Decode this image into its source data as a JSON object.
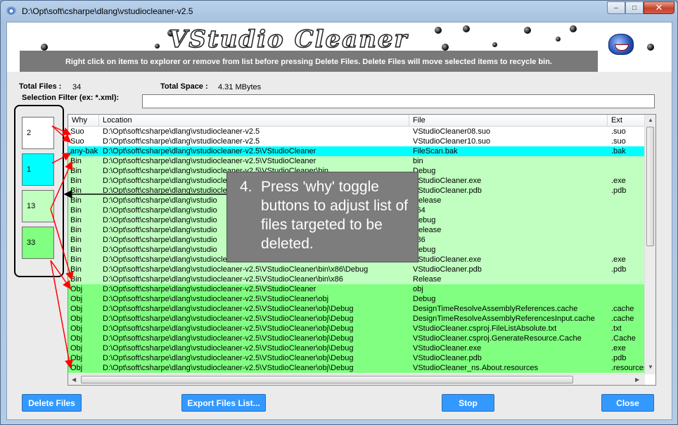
{
  "window": {
    "title": "D:\\Opt\\soft\\csharpe\\dlang\\vstudiocleaner-v2.5",
    "buttons": {
      "minimize": "–",
      "maximize": "□",
      "close": "✕"
    }
  },
  "banner": {
    "logo": "VStudio Cleaner",
    "instructions": "Right click on items to explorer or remove from list before pressing Delete Files.  Delete Files will move selected items to recycle bin."
  },
  "stats": {
    "total_files_label": "Total Files :",
    "total_files_value": "34",
    "total_space_label": "Total Space :",
    "total_space_value": "4.31 MBytes",
    "filter_label": "Selection Filter (ex: *.xml):",
    "filter_value": ""
  },
  "toggles": [
    {
      "count": "2",
      "color": "#ffffff"
    },
    {
      "count": "1",
      "color": "#00ffff"
    },
    {
      "count": "13",
      "color": "#c0ffc0"
    },
    {
      "count": "33",
      "color": "#80ff80"
    }
  ],
  "list": {
    "columns": [
      "Why",
      "Location",
      "File",
      "Ext"
    ],
    "rows": [
      {
        "why": "Suo",
        "location": "D:\\Opt\\soft\\csharpe\\dlang\\vstudiocleaner-v2.5",
        "file": "VStudioCleaner08.suo",
        "ext": ".suo",
        "color": "#ffffff"
      },
      {
        "why": "Suo",
        "location": "D:\\Opt\\soft\\csharpe\\dlang\\vstudiocleaner-v2.5",
        "file": "VStudioCleaner10.suo",
        "ext": ".suo",
        "color": "#ffffff"
      },
      {
        "why": "any-bak",
        "location": "D:\\Opt\\soft\\csharpe\\dlang\\vstudiocleaner-v2.5\\VStudioCleaner",
        "file": "FileScan.bak",
        "ext": ".bak",
        "color": "#00ffff"
      },
      {
        "why": "Bin",
        "location": "D:\\Opt\\soft\\csharpe\\dlang\\vstudiocleaner-v2.5\\VStudioCleaner",
        "file": "bin",
        "ext": "",
        "color": "#c0ffc0"
      },
      {
        "why": "Bin",
        "location": "D:\\Opt\\soft\\csharpe\\dlang\\vstudiocleaner-v2.5\\VStudioCleaner\\bin",
        "file": "Debug",
        "ext": "",
        "color": "#c0ffc0"
      },
      {
        "why": "Bin",
        "location": "D:\\Opt\\soft\\csharpe\\dlang\\vstudiocleaner-v2.5",
        "file": "VStudioCleaner.exe",
        "ext": ".exe",
        "color": "#c0ffc0"
      },
      {
        "why": "Bin",
        "location": "D:\\Opt\\soft\\csharpe\\dlang\\vstudiocleaner-v2.5",
        "file": "VStudioCleaner.pdb",
        "ext": ".pdb",
        "color": "#c0ffc0"
      },
      {
        "why": "Bin",
        "location": "D:\\Opt\\soft\\csharpe\\dlang\\vstudio",
        "file": "Release",
        "ext": "",
        "color": "#c0ffc0"
      },
      {
        "why": "Bin",
        "location": "D:\\Opt\\soft\\csharpe\\dlang\\vstudio",
        "file": "x64",
        "ext": "",
        "color": "#c0ffc0"
      },
      {
        "why": "Bin",
        "location": "D:\\Opt\\soft\\csharpe\\dlang\\vstudio",
        "file": "Debug",
        "ext": "",
        "color": "#c0ffc0"
      },
      {
        "why": "Bin",
        "location": "D:\\Opt\\soft\\csharpe\\dlang\\vstudio",
        "file": "Release",
        "ext": "",
        "color": "#c0ffc0"
      },
      {
        "why": "Bin",
        "location": "D:\\Opt\\soft\\csharpe\\dlang\\vstudio",
        "file": "x86",
        "ext": "",
        "color": "#c0ffc0"
      },
      {
        "why": "Bin",
        "location": "D:\\Opt\\soft\\csharpe\\dlang\\vstudio",
        "file": "Debug",
        "ext": "",
        "color": "#c0ffc0"
      },
      {
        "why": "Bin",
        "location": "D:\\Opt\\soft\\csharpe\\dlang\\vstudiocleaner-v2.5",
        "file": "VStudioCleaner.exe",
        "ext": ".exe",
        "color": "#c0ffc0"
      },
      {
        "why": "Bin",
        "location": "D:\\Opt\\soft\\csharpe\\dlang\\vstudiocleaner-v2.5\\VStudioCleaner\\bin\\x86\\Debug",
        "file": "VStudioCleaner.pdb",
        "ext": ".pdb",
        "color": "#c0ffc0"
      },
      {
        "why": "Bin",
        "location": "D:\\Opt\\soft\\csharpe\\dlang\\vstudiocleaner-v2.5\\VStudioCleaner\\bin\\x86",
        "file": "Release",
        "ext": "",
        "color": "#c0ffc0"
      },
      {
        "why": "Obj",
        "location": "D:\\Opt\\soft\\csharpe\\dlang\\vstudiocleaner-v2.5\\VStudioCleaner",
        "file": "obj",
        "ext": "",
        "color": "#80ff80"
      },
      {
        "why": "Obj",
        "location": "D:\\Opt\\soft\\csharpe\\dlang\\vstudiocleaner-v2.5\\VStudioCleaner\\obj",
        "file": "Debug",
        "ext": "",
        "color": "#80ff80"
      },
      {
        "why": "Obj",
        "location": "D:\\Opt\\soft\\csharpe\\dlang\\vstudiocleaner-v2.5\\VStudioCleaner\\obj\\Debug",
        "file": "DesignTimeResolveAssemblyReferences.cache",
        "ext": ".cache",
        "color": "#80ff80"
      },
      {
        "why": "Obj",
        "location": "D:\\Opt\\soft\\csharpe\\dlang\\vstudiocleaner-v2.5\\VStudioCleaner\\obj\\Debug",
        "file": "DesignTimeResolveAssemblyReferencesInput.cache",
        "ext": ".cache",
        "color": "#80ff80"
      },
      {
        "why": "Obj",
        "location": "D:\\Opt\\soft\\csharpe\\dlang\\vstudiocleaner-v2.5\\VStudioCleaner\\obj\\Debug",
        "file": "VStudioCleaner.csproj.FileListAbsolute.txt",
        "ext": ".txt",
        "color": "#80ff80"
      },
      {
        "why": "Obj",
        "location": "D:\\Opt\\soft\\csharpe\\dlang\\vstudiocleaner-v2.5\\VStudioCleaner\\obj\\Debug",
        "file": "VStudioCleaner.csproj.GenerateResource.Cache",
        "ext": ".Cache",
        "color": "#80ff80"
      },
      {
        "why": "Obj",
        "location": "D:\\Opt\\soft\\csharpe\\dlang\\vstudiocleaner-v2.5\\VStudioCleaner\\obj\\Debug",
        "file": "VStudioCleaner.exe",
        "ext": ".exe",
        "color": "#80ff80"
      },
      {
        "why": "Obj",
        "location": "D:\\Opt\\soft\\csharpe\\dlang\\vstudiocleaner-v2.5\\VStudioCleaner\\obj\\Debug",
        "file": "VStudioCleaner.pdb",
        "ext": ".pdb",
        "color": "#80ff80"
      },
      {
        "why": "Obj",
        "location": "D:\\Opt\\soft\\csharpe\\dlang\\vstudiocleaner-v2.5\\VStudioCleaner\\obj\\Debug",
        "file": "VStudioCleaner_ns.About.resources",
        "ext": ".resources",
        "color": "#80ff80"
      }
    ]
  },
  "callout": {
    "number": "4.",
    "text": "Press 'why' toggle buttons to adjust list of files targeted to be deleted."
  },
  "buttons": {
    "delete": "Delete Files",
    "export": "Export Files List...",
    "stop": "Stop",
    "close": "Close"
  },
  "colors": {
    "button_blue": "#3399ff",
    "selected_cyan": "#00ffff",
    "bin_green": "#c0ffc0",
    "obj_green": "#80ff80",
    "annotation_red": "#ff0000"
  }
}
